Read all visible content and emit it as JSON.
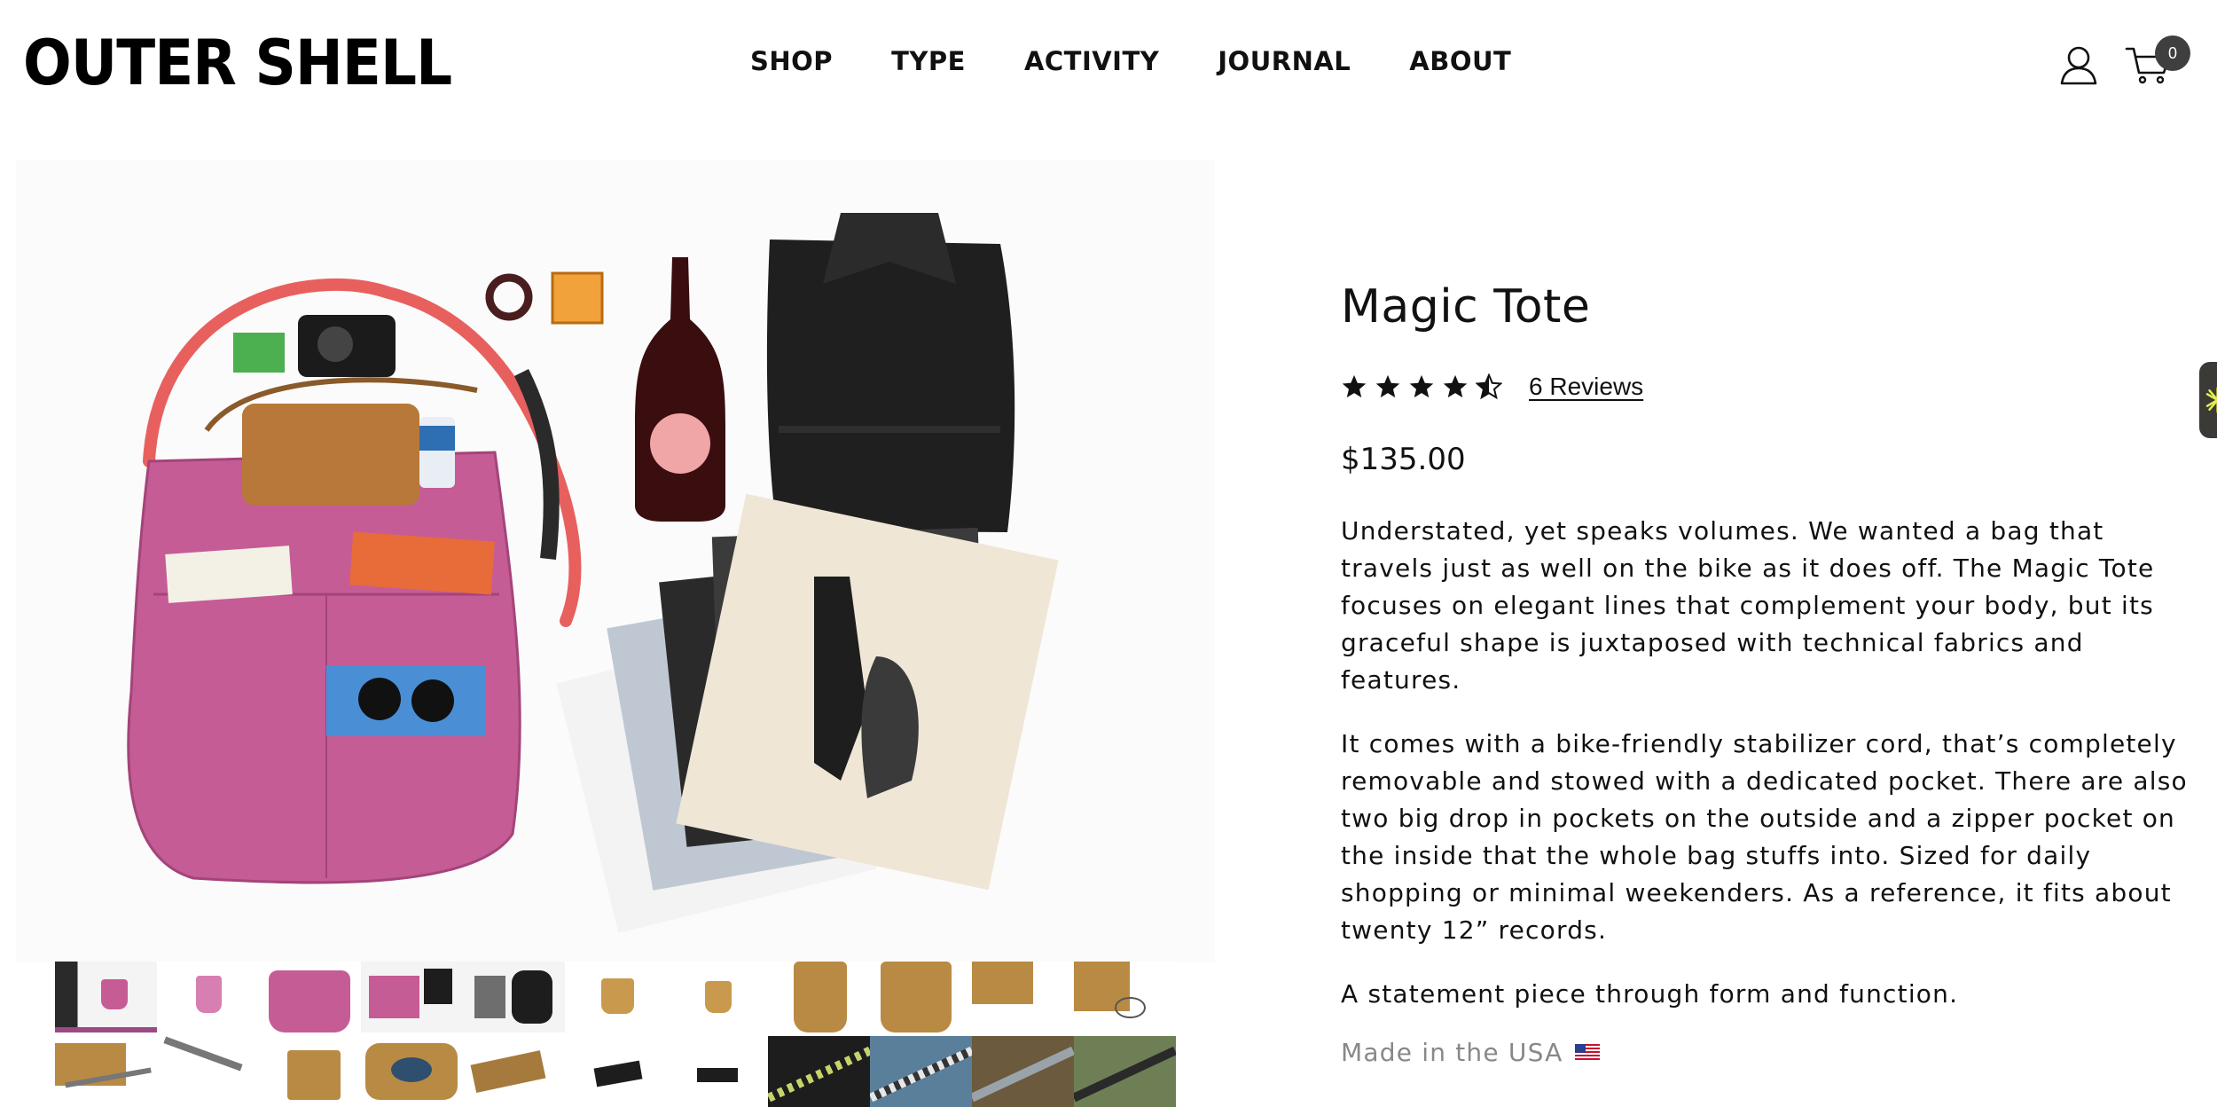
{
  "brand": {
    "name": "OUTER SHELL"
  },
  "nav": {
    "items": [
      "SHOP",
      "TYPE",
      "ACTIVITY",
      "JOURNAL",
      "ABOUT"
    ]
  },
  "header_icons": {
    "account": "user-icon",
    "cart": "cart-icon",
    "cart_count": "0"
  },
  "product": {
    "title": "Magic Tote",
    "rating": 4.5,
    "reviews_label": "6 Reviews",
    "price": "$135.00",
    "description": [
      "Understated, yet speaks volumes. We wanted a bag that travels just as well on the bike as it does off. The Magic Tote focuses on elegant lines that complement your body, but its graceful shape is juxtaposed with technical fabrics and features.",
      "It comes with a bike-friendly stabilizer cord, that’s completely removable and stowed with a dedicated pocket. There are also two big drop in pockets on the outside and a zipper pocket on the inside that the whole bag stuffs into. Sized for daily shopping or minimal weekenders. As a reference, it fits about twenty 12” records.",
      "A statement piece through form and function."
    ],
    "made_in": "Made in the USA",
    "made_in_flag": "us-flag-icon"
  },
  "gallery": {
    "main_image": "product-flatlay-image",
    "thumbnail_count": 22,
    "active_index": 0,
    "colors": {
      "pink": "#c65c95",
      "tan": "#b98a44",
      "dark": "#1d1d1d",
      "blue": "#5a7f9b",
      "olive": "#6e7f56",
      "accent": "#9b4a86"
    }
  }
}
